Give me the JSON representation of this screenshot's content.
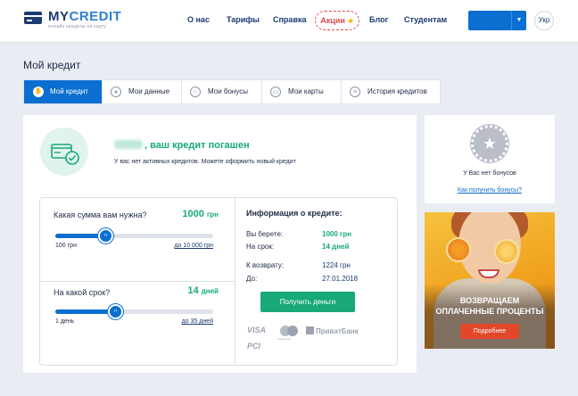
{
  "brand": {
    "name_part1": "MY",
    "name_part2": "CREDIT",
    "tagline": "онлайн кредиты на карту"
  },
  "nav": {
    "items": [
      "О нас",
      "Тарифы",
      "Справка",
      "Блог",
      "Студентам"
    ],
    "promo_label": "Акции",
    "promo_star": "★",
    "lang_label": "Укр",
    "login_caret": "▼"
  },
  "page": {
    "title": "Мой кредит"
  },
  "tabs": [
    {
      "label": "Мой кредит",
      "icon": "wallet-icon",
      "active": true
    },
    {
      "label": "Мои данные",
      "icon": "user-icon",
      "active": false
    },
    {
      "label": "Мои бонусы",
      "icon": "star-icon",
      "active": false
    },
    {
      "label": "Мои карты",
      "icon": "card-icon",
      "active": false
    },
    {
      "label": "История кредитов",
      "icon": "list-icon",
      "active": false
    }
  ],
  "status": {
    "title_suffix": ", ваш кредит погашен",
    "subtitle": "У вас нет активных кредитов. Можете оформить новый кредит"
  },
  "calculator": {
    "amount": {
      "question": "Какая сумма вам нужна?",
      "value": "1000",
      "unit": "грн",
      "min_label": "100 грн",
      "max_label": "до 10 000 грн",
      "fraction": 0.32
    },
    "term": {
      "question": "На какой срок?",
      "value": "14",
      "unit": "дней",
      "min_label": "1 день",
      "max_label": "до 35 дней",
      "fraction": 0.38
    },
    "thumb_glyph": "‹›"
  },
  "loan_info": {
    "title": "Информация о кредите:",
    "rows": [
      {
        "label": "Вы берете:",
        "value": "1000 грн"
      },
      {
        "label": "На срок:",
        "value": "14 дней"
      },
      {
        "label": "К возврату:",
        "value": "1224 грн"
      },
      {
        "label": "До:",
        "value": "27.01.2018"
      }
    ],
    "cta_label": "Получить деньги",
    "payment_logos": [
      "VISA",
      "mastercard",
      "ПриватБанк",
      "PCI"
    ]
  },
  "bonus": {
    "text": "У Вас нет бонусов",
    "link": "Как получить бонусы?",
    "badge_icon": "★"
  },
  "promo_banner": {
    "line1": "ВОЗВРАЩАЕМ",
    "line2": "ОПЛАЧЕННЫЕ ПРОЦЕНТЫ",
    "button_label": "Подробнее"
  },
  "colors": {
    "primary": "#0a6fd0",
    "success": "#18a87a",
    "promo_red": "#e04a4a",
    "background": "#e9edf3"
  }
}
